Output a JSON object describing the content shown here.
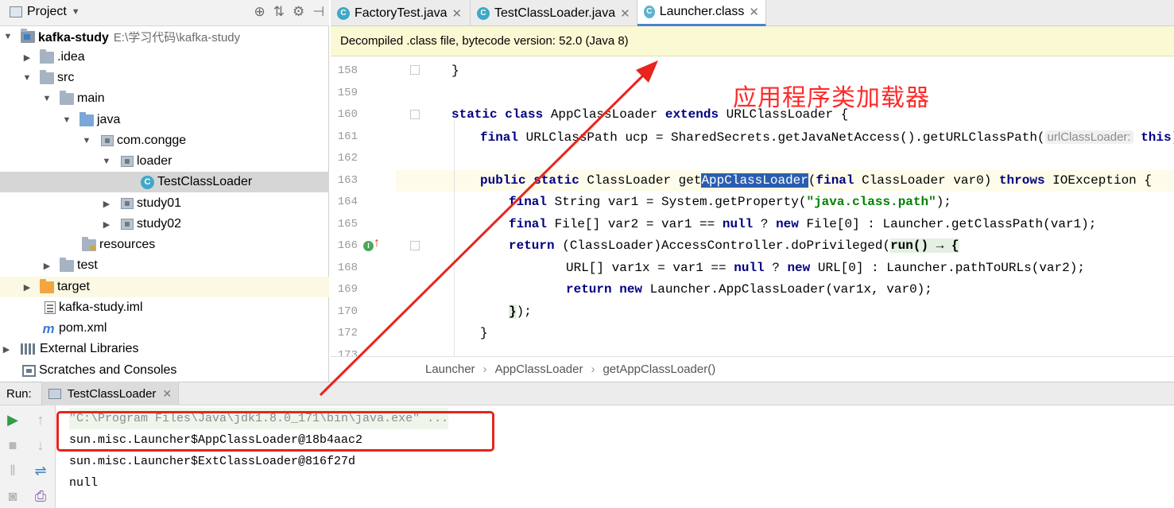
{
  "project_panel": {
    "title": "Project",
    "tree": [
      {
        "label": "kafka-study",
        "path": "E:\\学习代码\\kafka-study",
        "expanded": true
      },
      {
        "label": ".idea",
        "expanded": false
      },
      {
        "label": "src",
        "expanded": true
      },
      {
        "label": "main",
        "expanded": true
      },
      {
        "label": "java",
        "expanded": true
      },
      {
        "label": "com.congge",
        "expanded": true
      },
      {
        "label": "loader",
        "expanded": true
      },
      {
        "label": "TestClassLoader",
        "selected": true
      },
      {
        "label": "study01",
        "expanded": false
      },
      {
        "label": "study02",
        "expanded": false
      },
      {
        "label": "resources"
      },
      {
        "label": "test",
        "expanded": false
      },
      {
        "label": "target",
        "expanded": false
      },
      {
        "label": "kafka-study.iml"
      },
      {
        "label": "pom.xml"
      },
      {
        "label": "External Libraries",
        "expanded": false
      },
      {
        "label": "Scratches and Consoles"
      }
    ]
  },
  "editor": {
    "tabs": [
      {
        "label": "FactoryTest.java",
        "active": false
      },
      {
        "label": "TestClassLoader.java",
        "active": false
      },
      {
        "label": "Launcher.class",
        "active": true
      }
    ],
    "banner": "Decompiled .class file, bytecode version: 52.0 (Java 8)",
    "line_numbers": [
      "158",
      "159",
      "160",
      "161",
      "162",
      "163",
      "164",
      "165",
      "166",
      "168",
      "169",
      "170",
      "172",
      "173"
    ],
    "code": {
      "l158": "}",
      "l160_kw": "static class",
      "l160_a": " AppClassLoader ",
      "l160_kw2": "extends",
      "l160_b": " URLClassLoader {",
      "l161_kw": "final",
      "l161_a": " URLClassPath ucp = SharedSecrets.getJavaNetAccess().getURLClassPath(",
      "l161_hint": "urlClassLoader:",
      "l161_kw2": "this",
      "l161_b": ");",
      "l163_kw": "public static",
      "l163_a": " ClassLoader get",
      "l163_sel": "AppClassLoader",
      "l163_b": "(",
      "l163_kw2": "final",
      "l163_c": " ClassLoader var0) ",
      "l163_kw3": "throws",
      "l163_d": " IOException {",
      "l164_kw": "final",
      "l164_a": " String var1 = System.getProperty(",
      "l164_str": "\"java.class.path\"",
      "l164_b": ");",
      "l165_kw": "final",
      "l165_a": " File[] var2 = var1 == ",
      "l165_kw2": "null",
      "l165_b": " ? ",
      "l165_kw3": "new",
      "l165_c": " File[0] : Launcher.getClassPath(var1);",
      "l166_kw": "return",
      "l166_a": " (ClassLoader)AccessController.doPrivileged(",
      "l166_lambda": "run() → {",
      "l168_a": "URL[] var1x = var1 == ",
      "l168_kw": "null",
      "l168_b": " ? ",
      "l168_kw2": "new",
      "l168_c": " URL[0] : Launcher.pathToURLs(var2);",
      "l169_kw": "return new",
      "l169_a": " Launcher.AppClassLoader(var1x, var0);",
      "l170_lambda": "}",
      "l170_a": ");",
      "l172": "}"
    },
    "breadcrumb": [
      "Launcher",
      "AppClassLoader",
      "getAppClassLoader()"
    ]
  },
  "run_panel": {
    "label": "Run:",
    "tab": "TestClassLoader",
    "console_lines": [
      "\"C:\\Program Files\\Java\\jdk1.8.0_171\\bin\\java.exe\" ...",
      "sun.misc.Launcher$AppClassLoader@18b4aac2",
      "sun.misc.Launcher$ExtClassLoader@816f27d",
      "null"
    ]
  },
  "annotation": {
    "text": "应用程序类加载器",
    "color": "#ff2a2a"
  },
  "colors": {
    "keyword": "#000080",
    "string": "#008000",
    "selection": "#2a5db0",
    "banner": "#fbf8d4",
    "accent": "#4a83d4"
  }
}
